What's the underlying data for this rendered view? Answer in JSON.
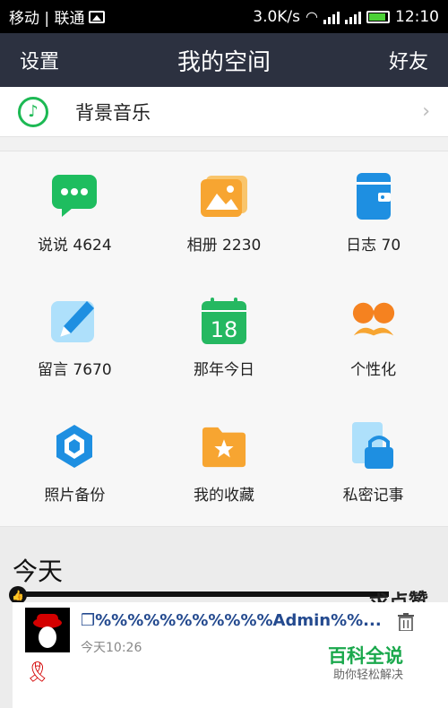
{
  "status": {
    "carrier": "移动 | 联通",
    "speed": "3.0K/s",
    "time": "12:10"
  },
  "nav": {
    "left": "设置",
    "title": "我的空间",
    "right": "好友"
  },
  "music": {
    "label": "背景音乐"
  },
  "grid": [
    {
      "label": "说说 4624",
      "icon": "chat-bubble-icon",
      "color": "#1ebd5f"
    },
    {
      "label": "相册 2230",
      "icon": "photo-album-icon",
      "color": "#f7a531"
    },
    {
      "label": "日志 70",
      "icon": "diary-icon",
      "color": "#1e8fe1"
    },
    {
      "label": "留言 7670",
      "icon": "pen-message-icon",
      "color": "#3aa3e3"
    },
    {
      "label": "那年今日",
      "icon": "calendar-icon",
      "color": "#25b861",
      "day": "18"
    },
    {
      "label": "个性化",
      "icon": "mustache-glasses-icon",
      "color": "#f58220"
    },
    {
      "label": "照片备份",
      "icon": "photo-backup-icon",
      "color": "#1e8fe1"
    },
    {
      "label": "我的收藏",
      "icon": "favorites-folder-icon",
      "color": "#f7a531"
    },
    {
      "label": "私密记事",
      "icon": "private-note-icon",
      "color": "#1e8fe1"
    }
  ],
  "today": {
    "title": "今天",
    "stamp": "求点赞",
    "post": {
      "title": "❒%%%%%%%%%%%Admin%%...",
      "time": "今天10:26"
    },
    "watermark": {
      "title": "百科全说",
      "subtitle": "助你轻松解决"
    }
  }
}
